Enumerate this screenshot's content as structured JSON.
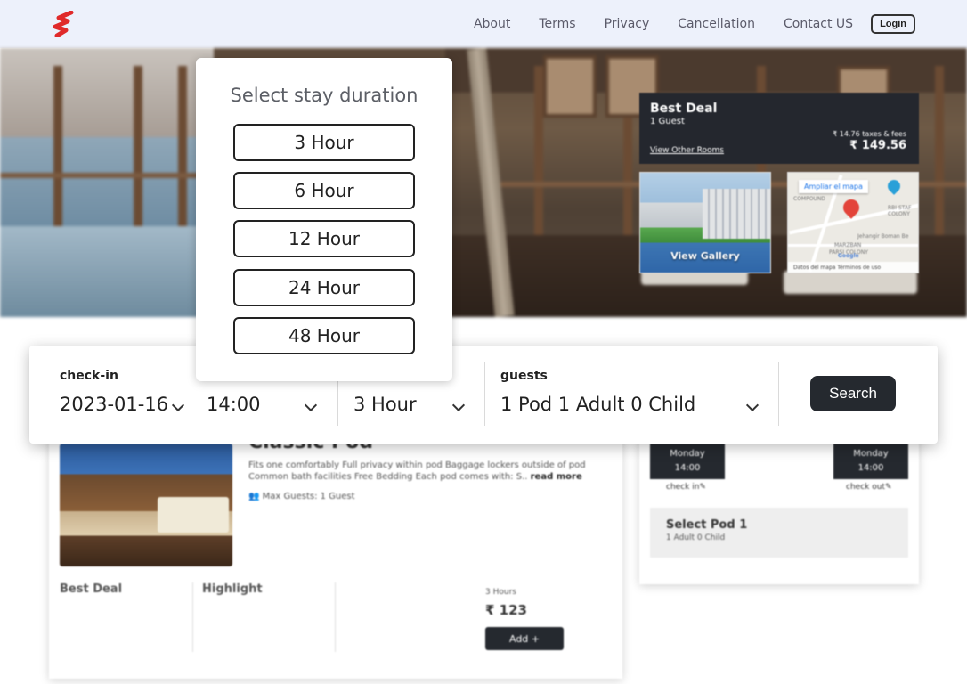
{
  "nav": {
    "logo": "brand-logo",
    "links": [
      "About",
      "Terms",
      "Privacy",
      "Cancellation",
      "Contact US"
    ],
    "login_label": "Login"
  },
  "deal": {
    "title": "Best Deal",
    "guests": "1 Guest",
    "link": "View Other Rooms",
    "taxes": "₹ 14.76 taxes & fees",
    "price": "₹ 149.56"
  },
  "gallery": {
    "label": "View Gallery"
  },
  "map": {
    "enlarge": "Ampliar el mapa",
    "labels": [
      "COMPOUND",
      "RBI STAF COLONY",
      "Jehangir Boman Be",
      "MARZBAN",
      "PARSI COLONY"
    ],
    "footer": "Datos del mapa   Términos de uso",
    "google": "Google"
  },
  "popup": {
    "title": "Select stay duration",
    "options": [
      "3 Hour",
      "6 Hour",
      "12 Hour",
      "24 Hour",
      "48 Hour"
    ]
  },
  "search": {
    "checkin_label": "check-in",
    "checkin_value": "2023-01-16",
    "time_value": "14:00",
    "duration_value": "3 Hour",
    "guests_label": "guests",
    "guests_value": "1 Pod 1 Adult 0 Child",
    "button": "Search"
  },
  "room": {
    "title": "Classic Pod",
    "desc": "Fits one comfortably Full privacy within pod Baggage lockers outside of pod Common bath facilities Free Bedding Each pod comes with: S..",
    "read_more": "read more",
    "max_guests": "Max Guests: 1 Guest",
    "best_deal": "Best Deal",
    "highlight": "Highlight",
    "hours": "3 Hours",
    "price": "₹ 123",
    "add": "Add +"
  },
  "booking": {
    "checkin_day": "Monday",
    "checkin_time": "14:00",
    "checkin_caption": "check in✎",
    "checkout_day": "Monday",
    "checkout_time": "14:00",
    "checkout_caption": "check out✎",
    "select_title": "Select Pod 1",
    "select_sub": "1 Adult 0 Child"
  },
  "colors": {
    "dark": "#25292f",
    "nav_bg": "#edf1fb",
    "logo_red": "#e02a2a"
  }
}
